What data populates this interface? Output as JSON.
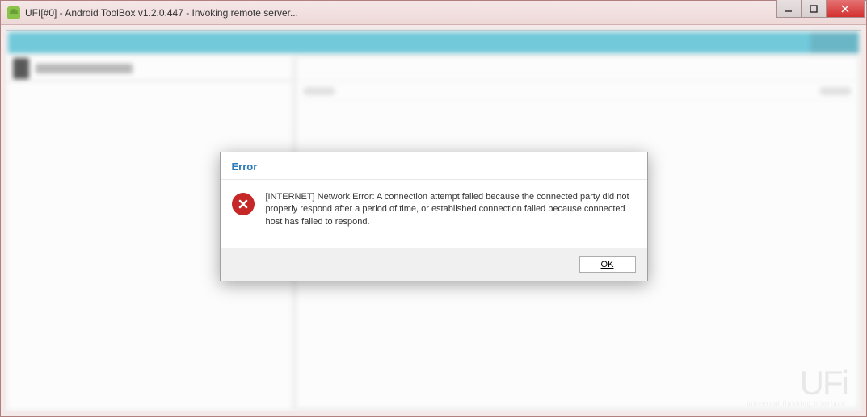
{
  "window": {
    "title": "UFI[#0] - Android ToolBox v1.2.0.447  - Invoking remote server..."
  },
  "dialog": {
    "title": "Error",
    "message": "[INTERNET] Network Error: A connection attempt failed because the connected party did not properly respond after a period of time, or established connection failed because connected host has failed to respond.",
    "ok_label": "OK"
  },
  "branding": {
    "logo": "UFi",
    "tagline": "universal flashing interface"
  }
}
